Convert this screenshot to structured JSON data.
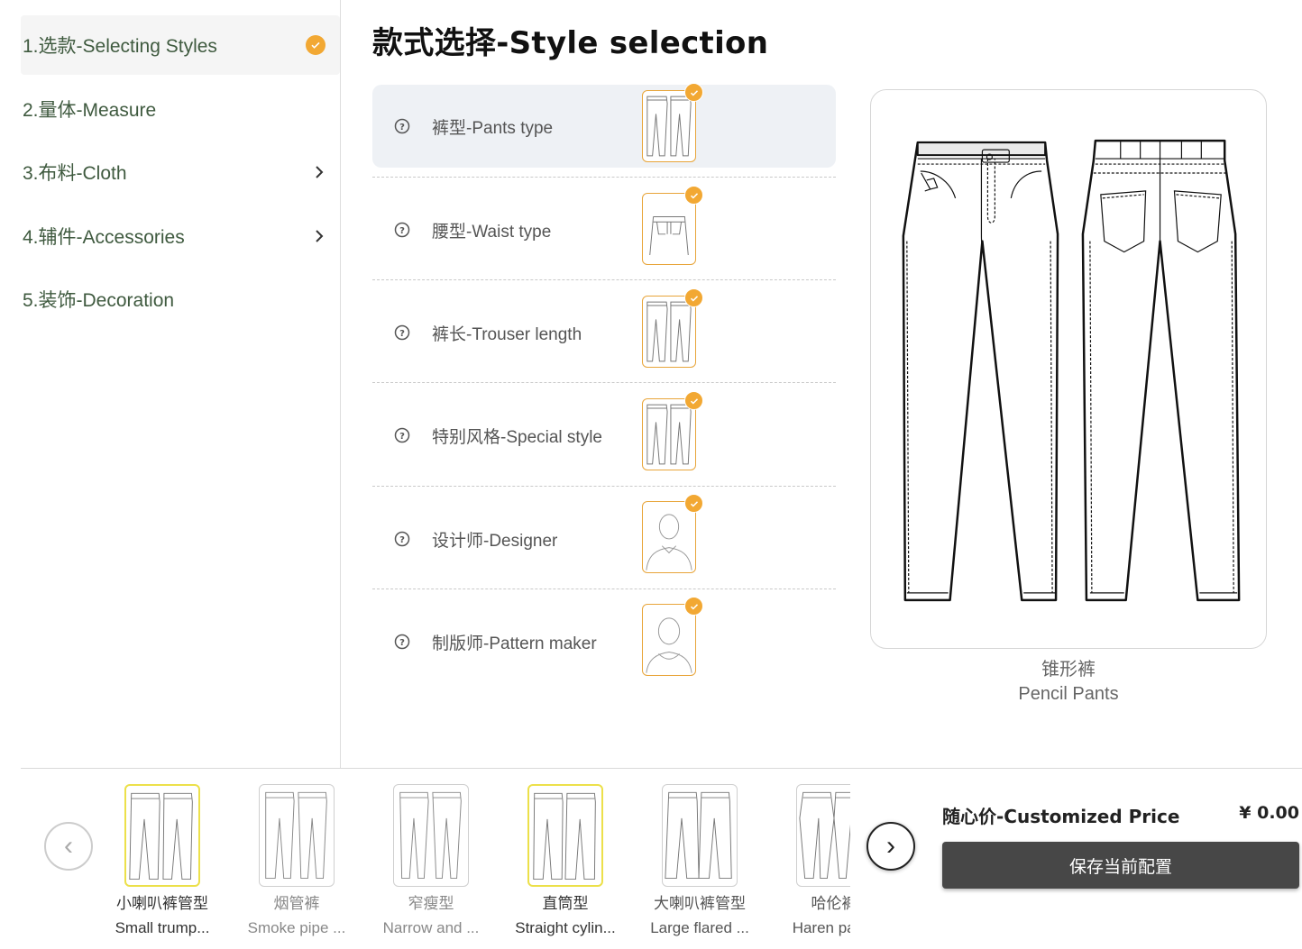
{
  "sidebar": {
    "items": [
      {
        "label": "1.选款-Selecting Styles",
        "state": "completed"
      },
      {
        "label": "2.量体-Measure"
      },
      {
        "label": "3.布料-Cloth",
        "has_submenu": true
      },
      {
        "label": "4.辅件-Accessories",
        "has_submenu": true
      },
      {
        "label": "5.装饰-Decoration"
      }
    ]
  },
  "main": {
    "title": "款式选择-Style selection",
    "options": [
      {
        "label": "裤型-Pants type",
        "thumb": "pants-front-back-icon"
      },
      {
        "label": "腰型-Waist type",
        "thumb": "waist-detail-icon"
      },
      {
        "label": "裤长-Trouser length",
        "thumb": "pants-front-back-icon"
      },
      {
        "label": "特别风格-Special style",
        "thumb": "pants-front-back-icon"
      },
      {
        "label": "设计师-Designer",
        "thumb": "person-avatar-icon"
      },
      {
        "label": "制版师-Pattern maker",
        "thumb": "person-avatar-icon"
      }
    ]
  },
  "preview": {
    "name_cn": "锥形裤",
    "name_en": "Pencil Pants"
  },
  "carousel": {
    "items": [
      {
        "cn": "小喇叭裤管型",
        "en": "Small trump...",
        "selected": true
      },
      {
        "cn": "烟管裤",
        "en": "Smoke pipe ...",
        "muted": true
      },
      {
        "cn": "窄瘦型",
        "en": "Narrow and ...",
        "muted": true
      },
      {
        "cn": "直筒型",
        "en": "Straight cylin...",
        "selected": true
      },
      {
        "cn": "大喇叭裤管型",
        "en": "Large flared ..."
      },
      {
        "cn": "哈伦裤",
        "en": "Haren pants"
      }
    ]
  },
  "footer": {
    "price_label": "随心价-Customized Price",
    "price_value": "¥ 0.00",
    "save_label": "保存当前配置"
  },
  "colors": {
    "accent": "#f2a833",
    "sidebar_text": "#3f5a3f",
    "save_button": "#474747",
    "selected_card_border": "#ece04a"
  }
}
